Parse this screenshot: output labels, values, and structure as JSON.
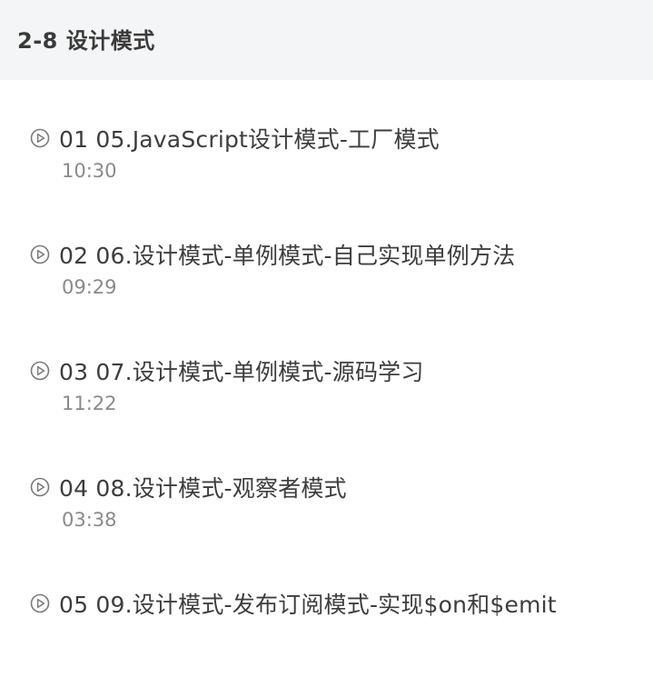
{
  "section": {
    "title": "2-8 设计模式"
  },
  "lessons": [
    {
      "title": "01 05.JavaScript设计模式-工厂模式",
      "duration": "10:30"
    },
    {
      "title": "02 06.设计模式-单例模式-自己实现单例方法",
      "duration": "09:29"
    },
    {
      "title": "03 07.设计模式-单例模式-源码学习",
      "duration": "11:22"
    },
    {
      "title": "04 08.设计模式-观察者模式",
      "duration": "03:38"
    },
    {
      "title": "05 09.设计模式-发布订阅模式-实现$on和$emit",
      "duration": ""
    }
  ],
  "icons": {
    "play": "play-circle-icon"
  },
  "colors": {
    "header_bg": "#f4f5f6",
    "title_text": "#3d3d3d",
    "duration_text": "#8a8a8a",
    "icon": "#7a7a7a"
  }
}
